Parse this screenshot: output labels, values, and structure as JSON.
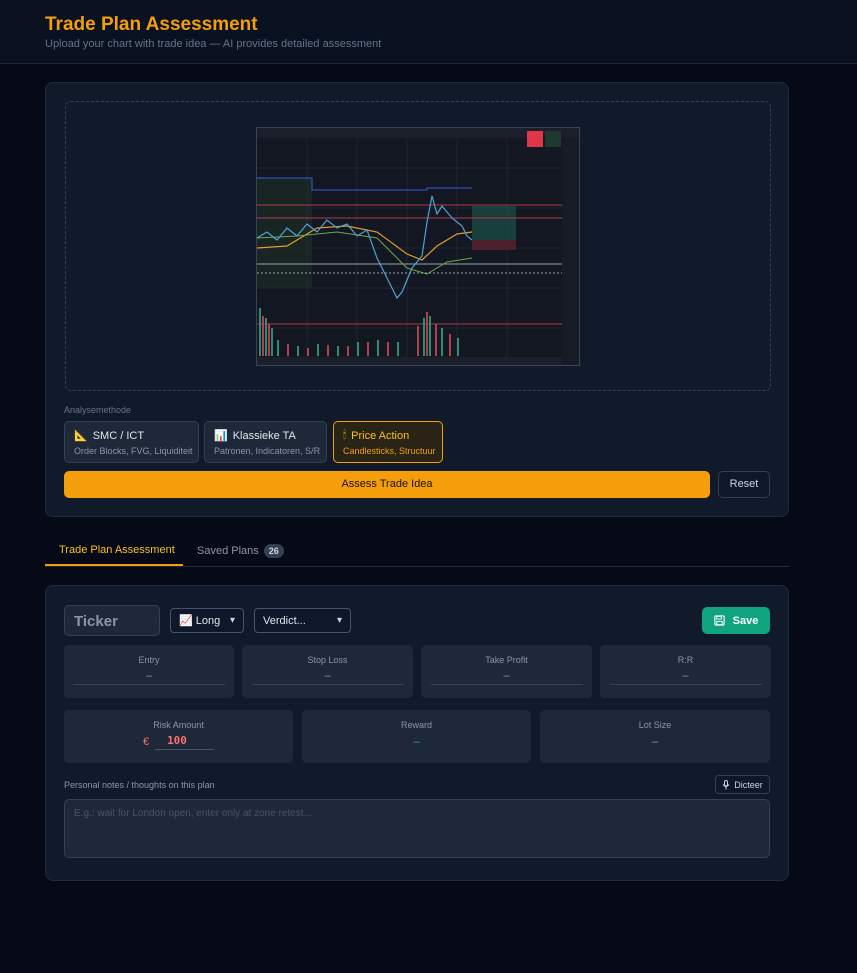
{
  "header": {
    "title": "Trade Plan Assessment",
    "subtitle": "Upload your chart with trade idea — AI provides detailed assessment"
  },
  "analysis": {
    "label": "Analysemethode",
    "methods": [
      {
        "icon": "ruler-icon",
        "glyph": "📐",
        "title": "SMC / ICT",
        "desc": "Order Blocks, FVG, Liquiditeit",
        "active": false
      },
      {
        "icon": "bar-chart-icon",
        "glyph": "📊",
        "title": "Klassieke TA",
        "desc": "Patronen, Indicatoren, S/R",
        "active": false
      },
      {
        "icon": "candle-icon",
        "glyph": "🕯",
        "title": "Price Action",
        "desc": "Candlesticks, Structuur",
        "active": true
      }
    ],
    "assess_label": "Assess Trade Idea",
    "reset_label": "Reset"
  },
  "tabs": {
    "assessment": "Trade Plan Assessment",
    "saved": "Saved Plans",
    "saved_count": "26"
  },
  "plan": {
    "ticker_placeholder": "Ticker",
    "direction": "📈 Long",
    "verdict": "Verdict...",
    "save_label": "Save",
    "stats": [
      {
        "label": "Entry",
        "value": "–"
      },
      {
        "label": "Stop Loss",
        "value": "–"
      },
      {
        "label": "Take Profit",
        "value": "–"
      },
      {
        "label": "R:R",
        "value": "–"
      }
    ],
    "risk": {
      "label": "Risk Amount",
      "currency": "€",
      "value": "100"
    },
    "reward": {
      "label": "Reward",
      "value": "–"
    },
    "lot": {
      "label": "Lot Size",
      "value": "–"
    },
    "notes_label": "Personal notes / thoughts on this plan",
    "dictate_label": "Dicteer",
    "notes_placeholder": "E.g.: wait for London open, enter only at zone retest..."
  },
  "colors": {
    "accent": "#f59e0b",
    "save": "#10a37f",
    "risk": "#f87171",
    "reward": "#10b981",
    "lot": "#60a5fa"
  }
}
